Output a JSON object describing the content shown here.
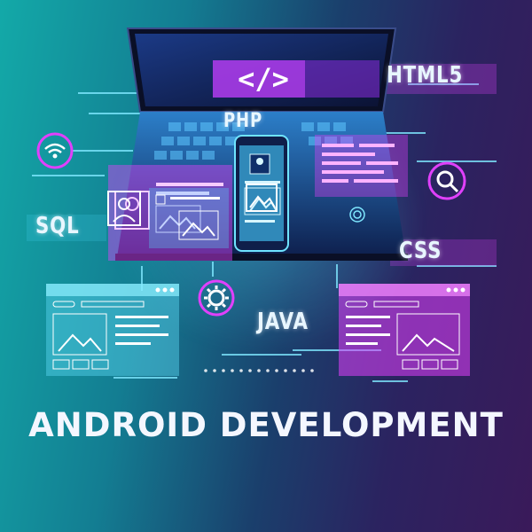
{
  "tech_labels": {
    "html5": "HTML5",
    "php": "PHP",
    "sql": "SQL",
    "css": "CSS",
    "java": "JAVA"
  },
  "laptop_screen": {
    "code_symbol": "</>"
  },
  "title": "ANDROID DEVELOPMENT",
  "icons": [
    "wifi-icon",
    "search-icon",
    "gear-icon",
    "image-icon",
    "user-icon",
    "fingerprint-icon"
  ],
  "colors": {
    "background_left": "#13a9a8",
    "background_right": "#3a1a5a",
    "magenta_accent": "#e040fb",
    "cyan_accent": "#4fe0ff",
    "title_text": "#f4f7ff"
  }
}
